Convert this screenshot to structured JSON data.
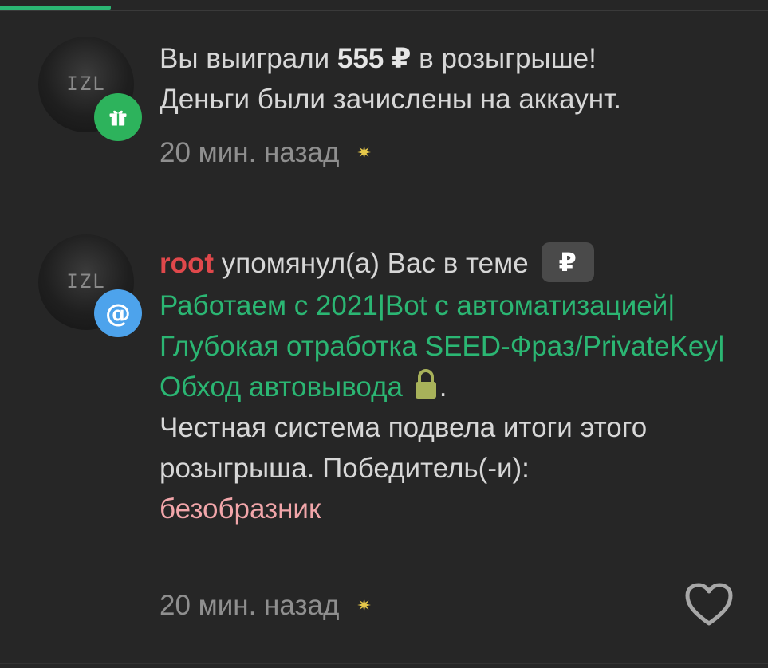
{
  "notifications": [
    {
      "avatar_text": "IZL",
      "badge_icon": "gift-icon",
      "message": {
        "line1_before": "Вы выиграли ",
        "amount": "555 ₽",
        "line1_after": " в розыгрыше!",
        "line2": "Деньги были зачислены на аккаунт."
      },
      "time": "20 мин. назад",
      "spark_icon": "sparkle-icon"
    },
    {
      "avatar_text": "IZL",
      "badge_icon": "at-icon",
      "badge_symbol": "@",
      "message": {
        "username": "root",
        "action": " упомянул(а) Вас в теме",
        "prefix": "₽",
        "thread_title": "Работаем с 2021|Bot с автоматизацией|Глубокая отработка SEED-Фраз/PrivateKey|Обход автовывода",
        "thread_end": ".",
        "body": "Честная система подвела итоги этого розыгрыша. Победитель(-и):",
        "winner": "безобразник"
      },
      "time": "20 мин. назад",
      "spark_icon": "sparkle-icon",
      "like_icon": "heart-icon"
    }
  ],
  "colors": {
    "background": "#262626",
    "accent_green": "#2bb673",
    "username_red": "#e0484b",
    "winner_pink": "#f2a6aa",
    "gift_badge": "#2db35c",
    "mention_badge": "#4da3ec"
  }
}
